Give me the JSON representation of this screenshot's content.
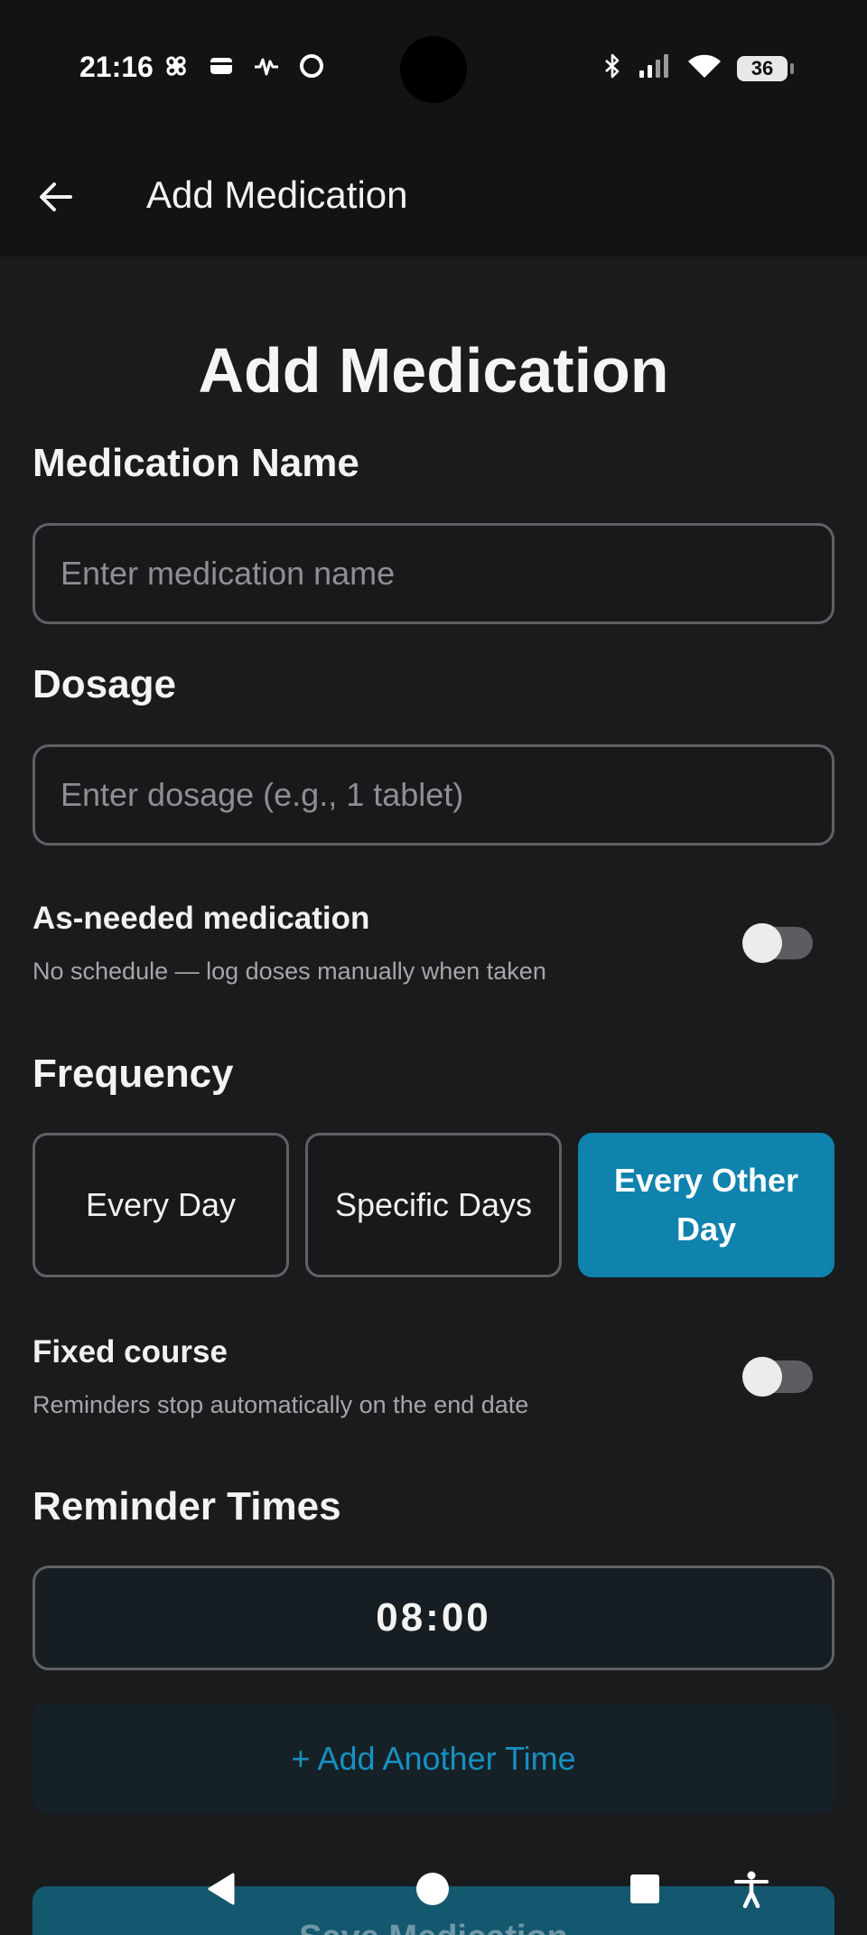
{
  "status_bar": {
    "time": "21:16",
    "battery": "36",
    "left_icons": [
      "pinwheel-icon",
      "wallet-icon",
      "activity-icon",
      "circle-notification-icon"
    ],
    "right_icons": [
      "bluetooth-icon",
      "signal-icon",
      "wifi-icon",
      "battery-icon"
    ]
  },
  "app_bar": {
    "title": "Add Medication",
    "back_icon": "arrow-left-icon"
  },
  "form": {
    "heading": "Add Medication",
    "medication_name": {
      "label": "Medication Name",
      "value": "",
      "placeholder": "Enter medication name"
    },
    "dosage": {
      "label": "Dosage",
      "value": "",
      "placeholder": "Enter dosage (e.g., 1 tablet)"
    },
    "as_needed": {
      "title": "As-needed medication",
      "subtitle": "No schedule — log doses manually when taken",
      "enabled": false
    },
    "frequency": {
      "label": "Frequency",
      "options": [
        "Every Day",
        "Specific Days",
        "Every Other Day"
      ],
      "selected": "Every Other Day"
    },
    "fixed_course": {
      "title": "Fixed course",
      "subtitle": "Reminders stop automatically on the end date",
      "enabled": false
    },
    "reminder_times": {
      "label": "Reminder Times",
      "times": [
        "08:00"
      ],
      "add_label": "+ Add Another Time"
    },
    "save_label": "Save Medication"
  },
  "colors": {
    "accent": "#0f82ad",
    "background": "#1a1b1d",
    "bar": "#131314",
    "link": "#1790c0"
  },
  "nav_bar": {
    "icons": [
      "back-triangle-icon",
      "home-circle-icon",
      "recents-square-icon",
      "accessibility-icon"
    ]
  }
}
